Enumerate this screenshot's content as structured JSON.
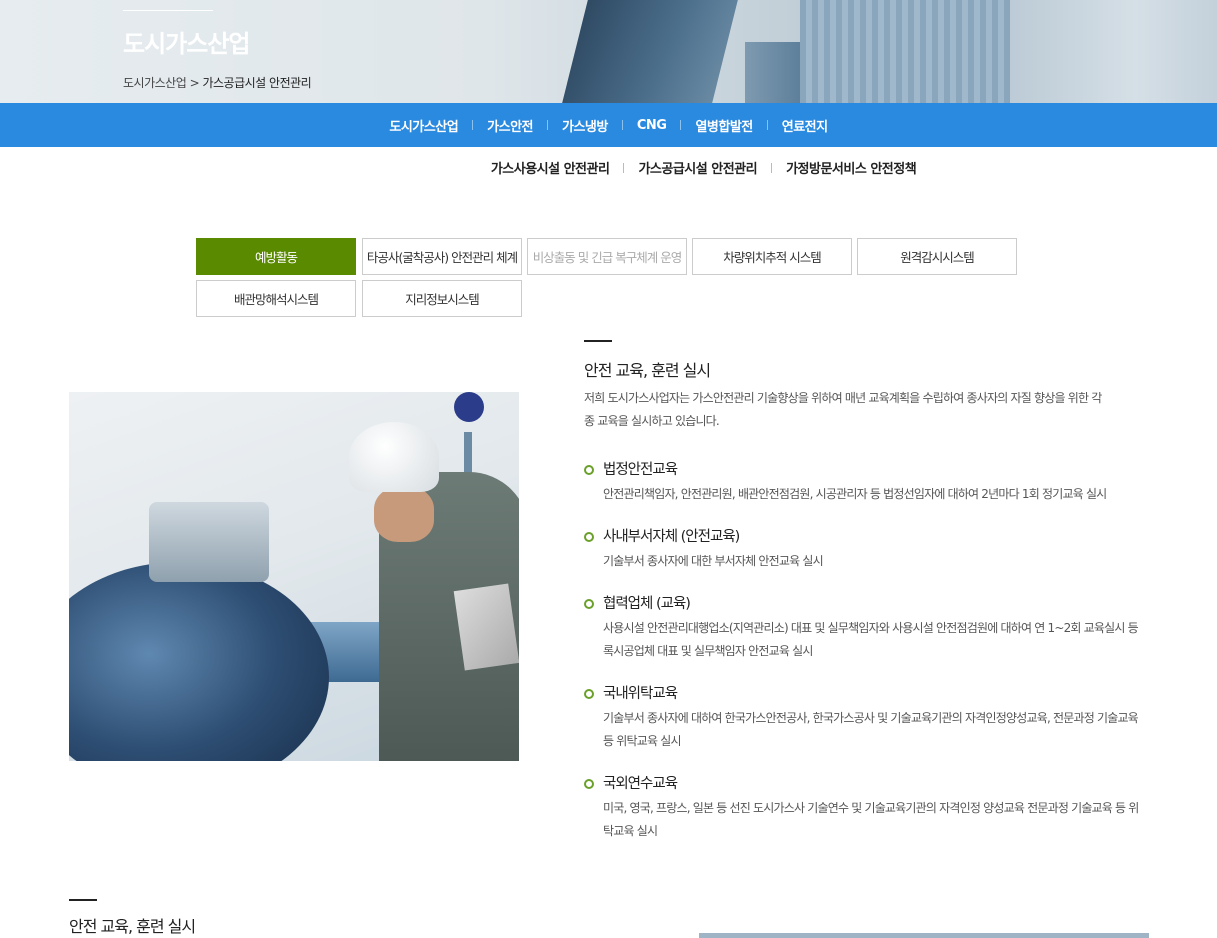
{
  "hero": {
    "title": "도시가스산업",
    "breadcrumb": [
      "도시가스산업",
      ">",
      "가스공급시설 안전관리"
    ]
  },
  "main_nav": [
    "도시가스산업",
    "가스안전",
    "가스냉방",
    "CNG",
    "열병합발전",
    "연료전지"
  ],
  "sub_nav": [
    "가스사용시설 안전관리",
    "가스공급시설 안전관리",
    "가정방문서비스 안전정책"
  ],
  "tabs": [
    {
      "label": "예방활동",
      "state": "active"
    },
    {
      "label": "타공사(굴착공사) 안전관리 체계",
      "state": "normal"
    },
    {
      "label": "비상출동 및 긴급 복구체계 운영",
      "state": "dim"
    },
    {
      "label": "차량위치추적 시스템",
      "state": "normal"
    },
    {
      "label": "원격감시시스템",
      "state": "normal"
    },
    {
      "label": "배관망해석시스템",
      "state": "normal"
    },
    {
      "label": "지리정보시스템",
      "state": "normal"
    }
  ],
  "section": {
    "title": "안전 교육, 훈련 실시",
    "intro": "저희 도시가스사업자는 가스안전관리 기술향상을 위하여 매년 교육계획을 수립하여 종사자의 자질 향상을 위한 각 종 교육을 실시하고 있습니다.",
    "items": [
      {
        "heading": "법정안전교육",
        "desc": "안전관리책임자, 안전관리원, 배관안전점검원, 시공관리자 등 법정선임자에 대하여 2년마다 1회 정기교육 실시"
      },
      {
        "heading": "사내부서자체 (안전교육)",
        "desc": "기술부서 종사자에 대한 부서자체 안전교육 실시"
      },
      {
        "heading": "협력업체 (교육)",
        "desc": "사용시설 안전관리대행업소(지역관리소) 대표 및 실무책임자와 사용시설 안전점검원에 대하여 연 1~2회 교육실시 등록시공업체 대표 및 실무책임자 안전교육 실시"
      },
      {
        "heading": "국내위탁교육",
        "desc": "기술부서 종사자에 대하여 한국가스안전공사, 한국가스공사 및 기술교육기관의 자격인정양성교육, 전문과정 기술교육 등 위탁교육 실시"
      },
      {
        "heading": "국외연수교육",
        "desc": "미국, 영국, 프랑스, 일본 등 선진 도시가스사 기술연수 및 기술교육기관의 자격인정 양성교육 전문과정 기술교육 등 위탁교육 실시"
      }
    ]
  },
  "section2": {
    "title": "안전 교육, 훈련 실시"
  },
  "colors": {
    "nav_blue": "#2a8ae0",
    "tab_active": "#5a8a00",
    "bullet_green": "#6aa02a"
  }
}
